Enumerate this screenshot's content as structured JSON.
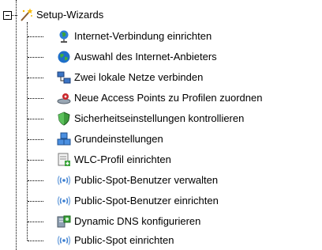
{
  "root": {
    "label": "Setup-Wizards",
    "icon": "magic-wand-icon"
  },
  "items": [
    {
      "name": "item-internet-verbindung",
      "label": "Internet-Verbindung einrichten",
      "icon": "globe-stand-icon"
    },
    {
      "name": "item-internet-anbieter",
      "label": "Auswahl des Internet-Anbieters",
      "icon": "globe-icon"
    },
    {
      "name": "item-zwei-netze",
      "label": "Zwei lokale Netze verbinden",
      "icon": "network-computers-icon"
    },
    {
      "name": "item-access-points",
      "label": "Neue Access Points zu Profilen zuordnen",
      "icon": "access-point-icon"
    },
    {
      "name": "item-sicherheit",
      "label": "Sicherheitseinstellungen kontrollieren",
      "icon": "shield-icon"
    },
    {
      "name": "item-grundeinstellungen",
      "label": "Grundeinstellungen",
      "icon": "device-stack-icon"
    },
    {
      "name": "item-wlc-profil",
      "label": "WLC-Profil einrichten",
      "icon": "profile-sheet-icon"
    },
    {
      "name": "item-public-spot-verwalten",
      "label": "Public-Spot-Benutzer verwalten",
      "icon": "wireless-signal-icon"
    },
    {
      "name": "item-public-spot-benutzer-einrichten",
      "label": "Public-Spot-Benutzer einrichten",
      "icon": "wireless-signal-icon"
    },
    {
      "name": "item-dynamic-dns",
      "label": "Dynamic DNS konfigurieren",
      "icon": "dns-server-icon"
    },
    {
      "name": "item-public-spot-einrichten",
      "label": "Public-Spot einrichten",
      "icon": "wireless-signal-icon"
    }
  ]
}
